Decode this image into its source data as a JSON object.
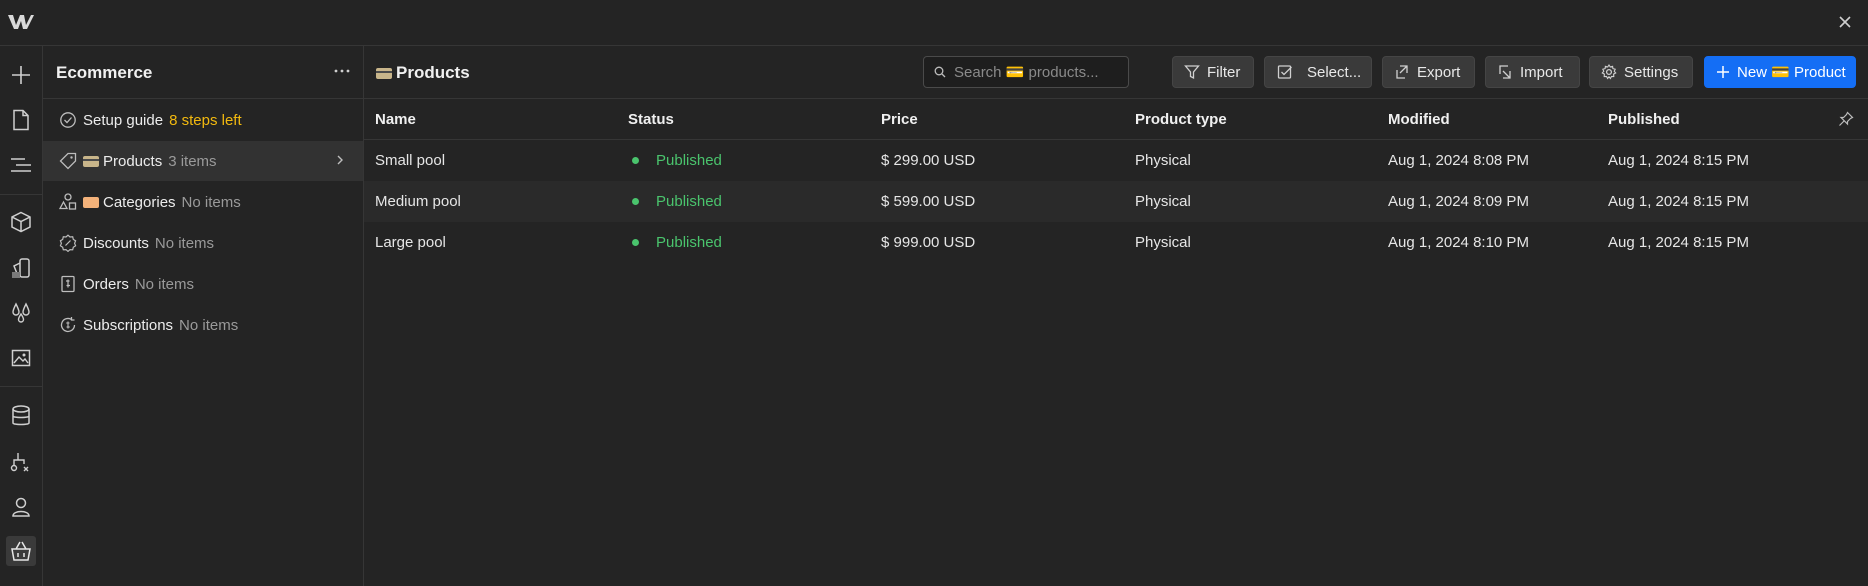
{
  "sidebar": {
    "title": "Ecommerce",
    "items": [
      {
        "label": "Setup guide",
        "count": "8 steps left"
      },
      {
        "label": "Products",
        "count": "3 items"
      },
      {
        "label": "Categories",
        "count": "No items"
      },
      {
        "label": "Discounts",
        "count": "No items"
      },
      {
        "label": "Orders",
        "count": "No items"
      },
      {
        "label": "Subscriptions",
        "count": "No items"
      }
    ]
  },
  "header": {
    "title": "Products",
    "search_placeholder": "Search 💳 products...",
    "filter_label": "Filter",
    "select_label": "Select...",
    "export_label": "Export",
    "import_label": "Import",
    "settings_label": "Settings",
    "new_label": "New 💳 Product"
  },
  "table": {
    "columns": [
      "Name",
      "Status",
      "Price",
      "Product type",
      "Modified",
      "Published"
    ],
    "rows": [
      {
        "name": "Small pool",
        "status": "Published",
        "price": "$ 299.00 USD",
        "type": "Physical",
        "modified": "Aug 1, 2024 8:08 PM",
        "published": "Aug 1, 2024 8:15 PM"
      },
      {
        "name": "Medium pool",
        "status": "Published",
        "price": "$ 599.00 USD",
        "type": "Physical",
        "modified": "Aug 1, 2024 8:09 PM",
        "published": "Aug 1, 2024 8:15 PM"
      },
      {
        "name": "Large pool",
        "status": "Published",
        "price": "$ 999.00 USD",
        "type": "Physical",
        "modified": "Aug 1, 2024 8:10 PM",
        "published": "Aug 1, 2024 8:15 PM"
      }
    ]
  },
  "colors": {
    "accent": "#146ef5",
    "published": "#4ac46d",
    "warning": "#f2b90f"
  }
}
